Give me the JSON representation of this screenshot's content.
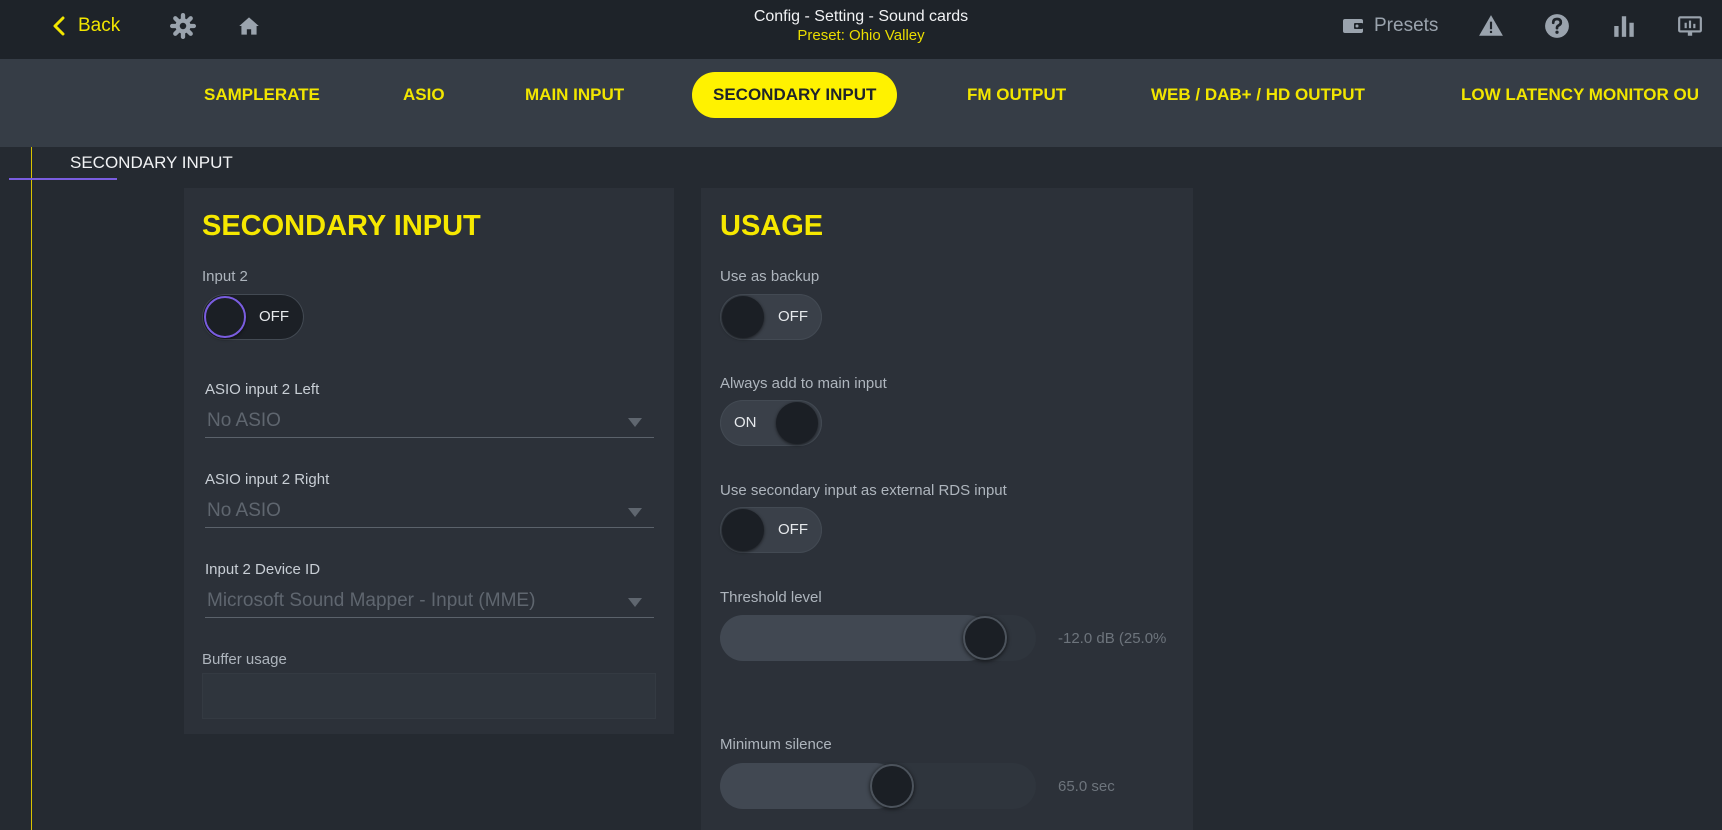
{
  "header": {
    "back_label": "Back",
    "title": "Config - Setting - Sound cards",
    "subtitle": "Preset: Ohio Valley",
    "presets_label": "Presets"
  },
  "tabs": [
    {
      "label": "SAMPLERATE",
      "active": false
    },
    {
      "label": "ASIO",
      "active": false
    },
    {
      "label": "MAIN INPUT",
      "active": false
    },
    {
      "label": "SECONDARY INPUT",
      "active": true
    },
    {
      "label": "FM OUTPUT",
      "active": false
    },
    {
      "label": "WEB / DAB+ / HD OUTPUT",
      "active": false
    },
    {
      "label": "LOW LATENCY MONITOR OU",
      "active": false
    }
  ],
  "section": {
    "label": "SECONDARY INPUT"
  },
  "secondary_input": {
    "title": "SECONDARY INPUT",
    "input2": {
      "label": "Input 2",
      "state": "OFF"
    },
    "asio_left": {
      "label": "ASIO input 2 Left",
      "value": "No ASIO"
    },
    "asio_right": {
      "label": "ASIO input 2 Right",
      "value": "No ASIO"
    },
    "device_id": {
      "label": "Input 2 Device ID",
      "value": "Microsoft Sound Mapper - Input (MME)"
    },
    "buffer_usage": {
      "label": "Buffer usage"
    }
  },
  "usage": {
    "title": "USAGE",
    "use_as_backup": {
      "label": "Use as backup",
      "state": "OFF"
    },
    "always_add": {
      "label": "Always add to main input",
      "state": "ON"
    },
    "external_rds": {
      "label": "Use secondary input as external RDS input",
      "state": "OFF"
    },
    "threshold": {
      "label": "Threshold level",
      "value_text": "-12.0 dB (25.0%"
    },
    "min_silence": {
      "label": "Minimum silence",
      "value_text": "65.0 sec"
    }
  },
  "colors": {
    "accent": "#f2e600",
    "focus": "#7a5de0",
    "background": "#252a31"
  },
  "icons": [
    "chevron-left-icon",
    "gear-icon",
    "home-icon",
    "wallet-icon",
    "warning-icon",
    "help-icon",
    "bar-chart-icon",
    "monitor-icon"
  ]
}
